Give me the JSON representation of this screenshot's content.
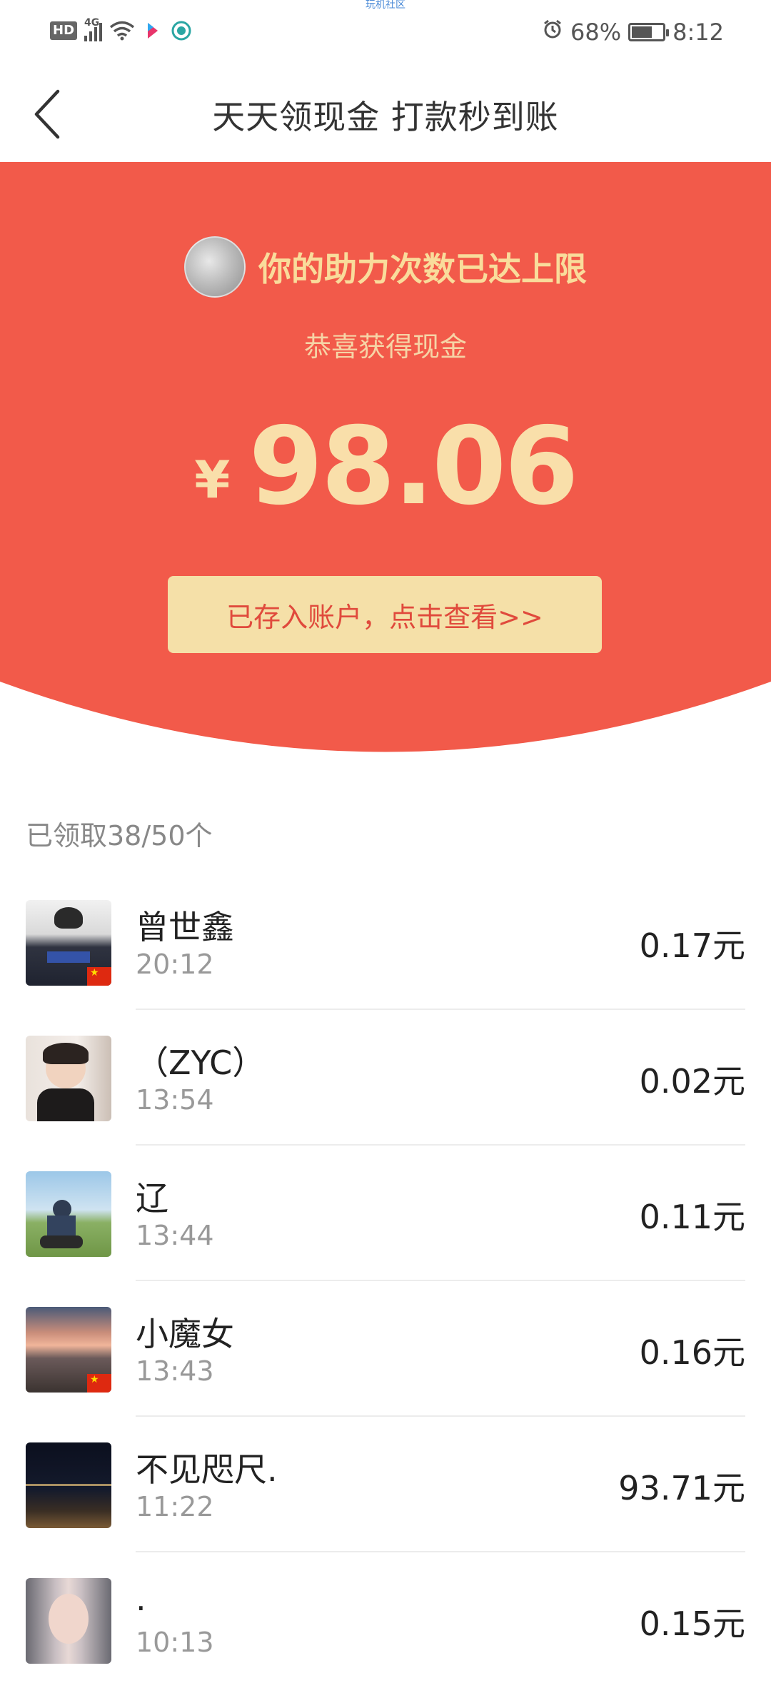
{
  "watermark": "玩机社区",
  "status_bar": {
    "network_badge": "HD",
    "network_type": "4G",
    "battery_percent": "68%",
    "battery_level": 0.68,
    "time": "8:12"
  },
  "nav": {
    "title": "天天领现金 打款秒到账"
  },
  "hero": {
    "helper_text": "你的助力次数已达上限",
    "subtitle": "恭喜获得现金",
    "currency": "¥",
    "amount": "98.06",
    "deposit_button": "已存入账户，点击查看>>"
  },
  "claimed_count": "已领取38/50个",
  "items": [
    {
      "name": "曾世鑫",
      "time": "20:12",
      "amount": "0.17元"
    },
    {
      "name": "（ZYC）",
      "time": "13:54",
      "amount": "0.02元"
    },
    {
      "name": "辽",
      "time": "13:44",
      "amount": "0.11元"
    },
    {
      "name": "小魔女",
      "time": "13:43",
      "amount": "0.16元"
    },
    {
      "name": "不见咫尺.",
      "time": "11:22",
      "amount": "93.71元"
    },
    {
      "name": ".",
      "time": "10:13",
      "amount": "0.15元"
    }
  ],
  "colors": {
    "hero_red": "#f25a4a",
    "gold_text": "#f9dfaa",
    "button_bg": "#f5e0a8",
    "button_text": "#e04a3c"
  }
}
